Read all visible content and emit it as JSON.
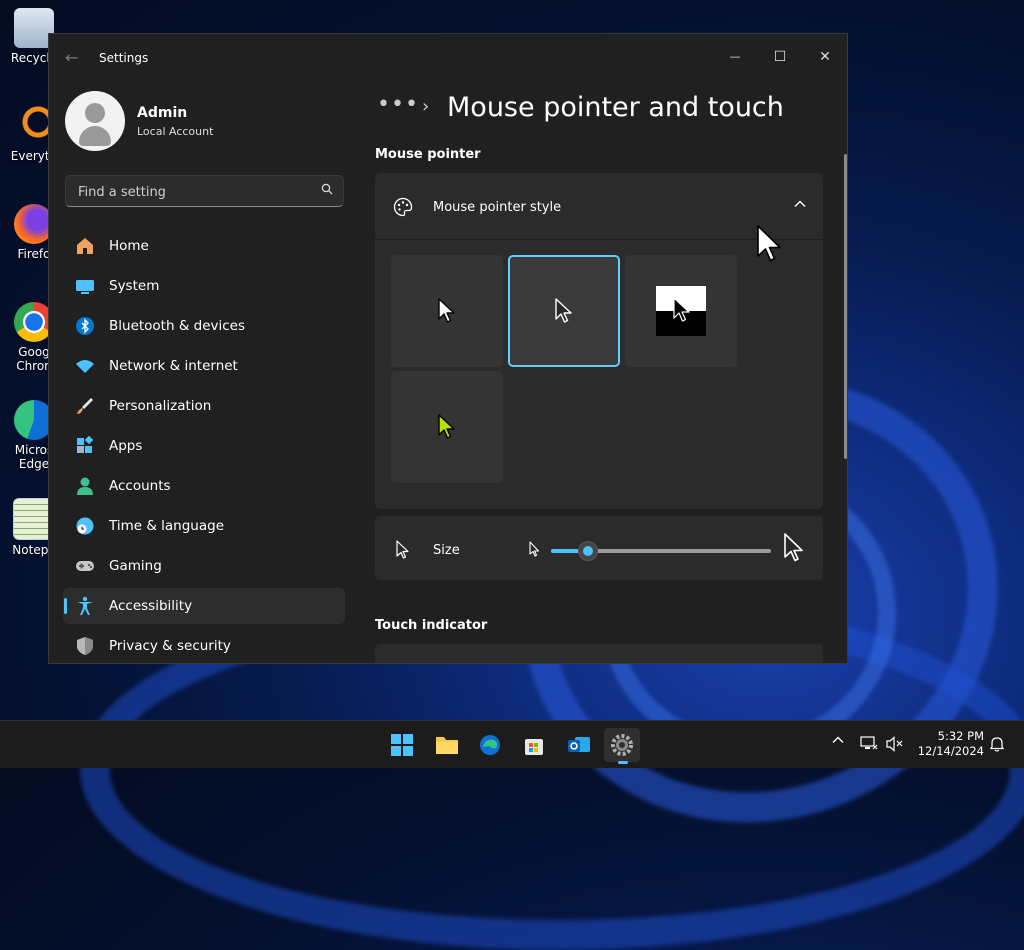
{
  "desktop": {
    "icons": [
      {
        "label": "Recycle",
        "icon": "recycle-bin-icon"
      },
      {
        "label": "Everyth",
        "icon": "everything-search-icon"
      },
      {
        "label": "Firefo",
        "icon": "firefox-icon"
      },
      {
        "label": "Goog\nChron",
        "icon": "chrome-icon"
      },
      {
        "label": "Micros\nEdge",
        "icon": "edge-icon"
      },
      {
        "label": "Notepa",
        "icon": "notepad-icon"
      }
    ]
  },
  "window": {
    "title": "Settings",
    "controls": {
      "minimize": "—",
      "maximize": "☐",
      "close": "✕"
    }
  },
  "sidebar": {
    "user": {
      "name": "Admin",
      "account_type": "Local Account"
    },
    "search": {
      "placeholder": "Find a setting"
    },
    "items": [
      {
        "label": "Home",
        "icon": "home-icon"
      },
      {
        "label": "System",
        "icon": "system-icon"
      },
      {
        "label": "Bluetooth & devices",
        "icon": "bluetooth-icon"
      },
      {
        "label": "Network & internet",
        "icon": "wifi-icon"
      },
      {
        "label": "Personalization",
        "icon": "brush-icon"
      },
      {
        "label": "Apps",
        "icon": "apps-icon"
      },
      {
        "label": "Accounts",
        "icon": "accounts-icon"
      },
      {
        "label": "Time & language",
        "icon": "globe-clock-icon"
      },
      {
        "label": "Gaming",
        "icon": "gamepad-icon"
      },
      {
        "label": "Accessibility",
        "icon": "accessibility-icon",
        "active": true
      },
      {
        "label": "Privacy & security",
        "icon": "shield-icon"
      }
    ]
  },
  "main": {
    "breadcrumb_more": "•••",
    "breadcrumb_sep": "›",
    "title": "Mouse pointer and touch",
    "section_pointer": "Mouse pointer",
    "pointer_style": {
      "label": "Mouse pointer style",
      "expanded": true,
      "options": [
        {
          "name": "white",
          "fill": "#ffffff",
          "stroke": "#000000",
          "selected": false
        },
        {
          "name": "black",
          "fill": "#000000",
          "stroke": "#ffffff",
          "selected": true
        },
        {
          "name": "inverted",
          "fill": "#ffffff",
          "stroke": "#000000",
          "selected": false
        },
        {
          "name": "custom",
          "fill": "#b6e000",
          "stroke": "#000000",
          "selected": false
        }
      ]
    },
    "size": {
      "label": "Size",
      "value_fraction": 0.17
    },
    "section_touch": "Touch indicator"
  },
  "taskbar": {
    "apps": [
      "start-icon",
      "file-explorer-icon",
      "edge-icon",
      "store-icon",
      "outlook-icon",
      "settings-icon"
    ],
    "active_app": "settings-icon",
    "time": "5:32 PM",
    "date": "12/14/2024"
  },
  "colors": {
    "accent": "#4cc2ff",
    "window_bg": "#202020",
    "card_bg": "#2b2b2b"
  }
}
